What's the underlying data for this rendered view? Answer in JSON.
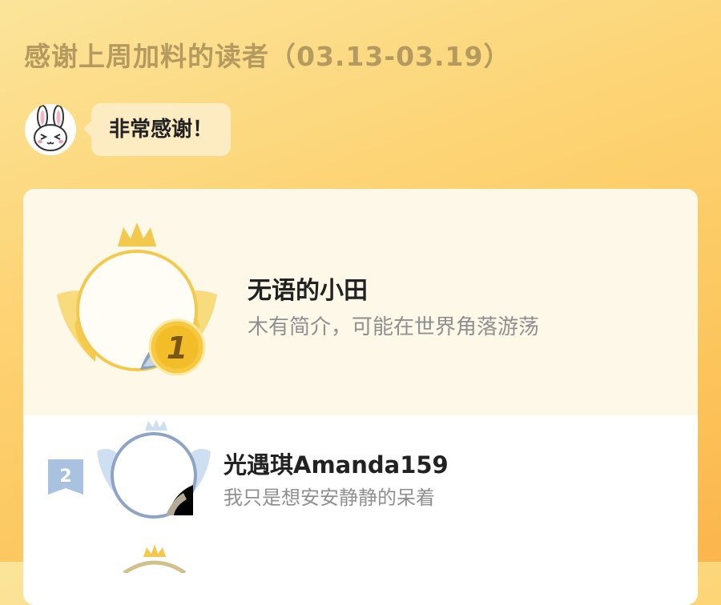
{
  "header": {
    "title": "感谢上周加料的读者（03.13-03.19）"
  },
  "bubble": {
    "text": "非常感谢！"
  },
  "ranking": [
    {
      "rank": "1",
      "name": "无语的小田",
      "bio": "木有简介，可能在世界角落游荡"
    },
    {
      "rank": "2",
      "name": "光遇琪Amanda159",
      "bio": "我只是想安安静静的呆着"
    }
  ],
  "colors": {
    "gold": "#f2c94c",
    "silver": "#8ea4c4",
    "bubble": "#fdecc1",
    "title": "#b59a5f"
  }
}
